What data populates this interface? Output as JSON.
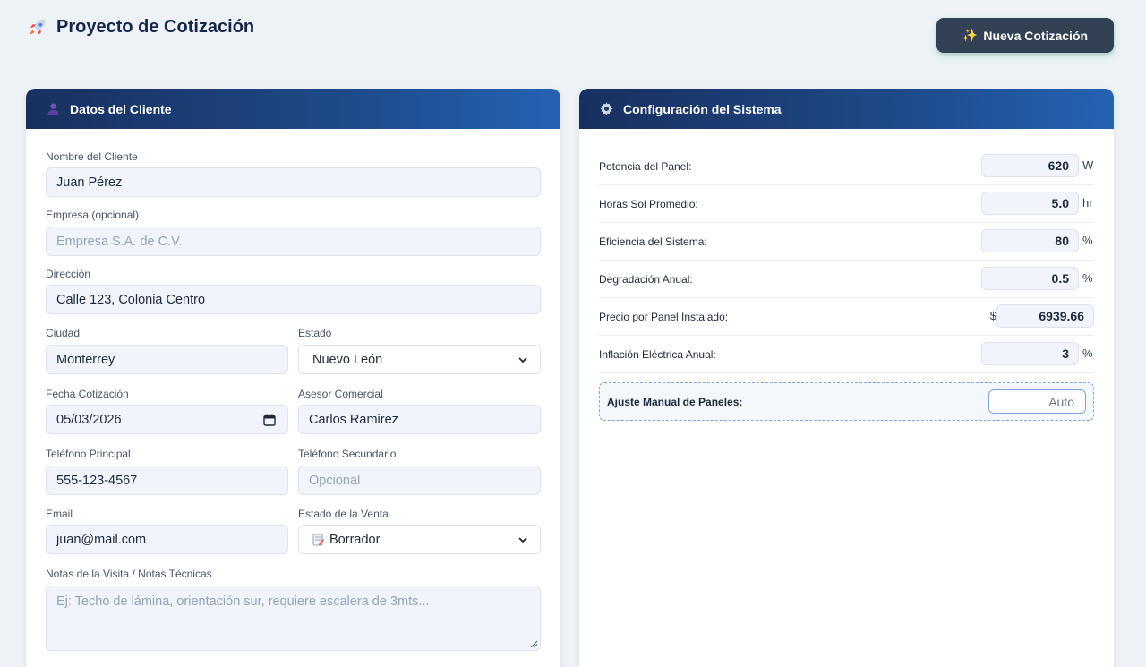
{
  "app": {
    "title": "Proyecto de Cotización",
    "icon": "rocket-icon",
    "new_button": "Nueva Cotización",
    "new_button_icon": "sparkles-icon"
  },
  "client_card": {
    "title": "Datos del Cliente",
    "icon": "user-icon",
    "fields": {
      "nombre": {
        "label": "Nombre del Cliente",
        "value": "Juan Pérez"
      },
      "empresa": {
        "label": "Empresa (opcional)",
        "placeholder": "Empresa S.A. de C.V."
      },
      "direccion": {
        "label": "Dirección",
        "value": "Calle 123, Colonia Centro"
      },
      "ciudad": {
        "label": "Ciudad",
        "value": "Monterrey"
      },
      "estado": {
        "label": "Estado",
        "value": "Nuevo León"
      },
      "fecha": {
        "label": "Fecha Cotización",
        "value": "05/03/2026"
      },
      "asesor": {
        "label": "Asesor Comercial",
        "value": "Carlos Ramirez"
      },
      "tel1": {
        "label": "Teléfono Principal",
        "value": "555-123-4567"
      },
      "tel2": {
        "label": "Teléfono Secundario",
        "placeholder": "Opcional"
      },
      "email": {
        "label": "Email",
        "value": "juan@mail.com"
      },
      "estado_venta": {
        "label": "Estado de la Venta",
        "value": "Borrador",
        "icon": "memo-icon"
      },
      "notas": {
        "label": "Notas de la Visita / Notas Técnicas",
        "placeholder": "Ej: Techo de lámina, orientación sur, requiere escalera de 3mts..."
      }
    }
  },
  "system_card": {
    "title": "Configuración del Sistema",
    "icon": "gear-icon",
    "rows": [
      {
        "label": "Potencia del Panel:",
        "value": "620",
        "unit": "W"
      },
      {
        "label": "Horas Sol Promedio:",
        "value": "5.0",
        "unit": "hr"
      },
      {
        "label": "Eficiencia del Sistema:",
        "value": "80",
        "unit": "%"
      },
      {
        "label": "Degradación Anual:",
        "value": "0.5",
        "unit": "%"
      },
      {
        "label": "Precio por Panel Instalado:",
        "value": "6939.66",
        "prefix": "$"
      },
      {
        "label": "Inflación Eléctrica Anual:",
        "value": "3",
        "unit": "%"
      }
    ],
    "manual": {
      "label": "Ajuste Manual de Paneles:",
      "placeholder": "Auto"
    }
  },
  "colors": {
    "header_gradient_start": "#18305e",
    "header_gradient_end": "#2563b3",
    "button_bg": "#334155",
    "page_bg": "#eef2f7"
  }
}
